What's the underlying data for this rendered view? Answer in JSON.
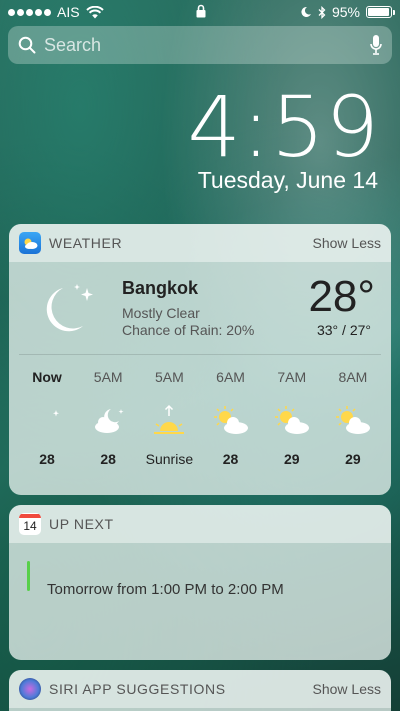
{
  "status_bar": {
    "carrier": "AIS",
    "battery_percent_text": "95%",
    "battery_level": 0.95
  },
  "search": {
    "placeholder": "Search"
  },
  "lock_screen": {
    "time": "4:59",
    "date": "Tuesday, June 14"
  },
  "weather_widget": {
    "title": "WEATHER",
    "action": "Show Less",
    "city": "Bangkok",
    "condition": "Mostly Clear",
    "rain": "Chance of Rain: 20%",
    "temperature": "28°",
    "range": "33° / 27°",
    "hourly": [
      {
        "label": "Now",
        "icon": "moon-icon",
        "temp": "28"
      },
      {
        "label": "5AM",
        "icon": "moon-cloud-icon",
        "temp": "28"
      },
      {
        "label": "5AM",
        "icon": "sunrise-icon",
        "temp": "Sunrise"
      },
      {
        "label": "6AM",
        "icon": "sun-cloud-icon",
        "temp": "28"
      },
      {
        "label": "7AM",
        "icon": "sun-cloud-icon",
        "temp": "29"
      },
      {
        "label": "8AM",
        "icon": "sun-cloud-icon",
        "temp": "29"
      }
    ]
  },
  "upnext_widget": {
    "title": "UP NEXT",
    "calendar_day": "14",
    "event_time": "Tomorrow from 1:00 PM to 2:00 PM",
    "event_color": "#57d04a"
  },
  "siri_widget": {
    "title": "SIRI APP SUGGESTIONS",
    "action": "Show Less"
  }
}
